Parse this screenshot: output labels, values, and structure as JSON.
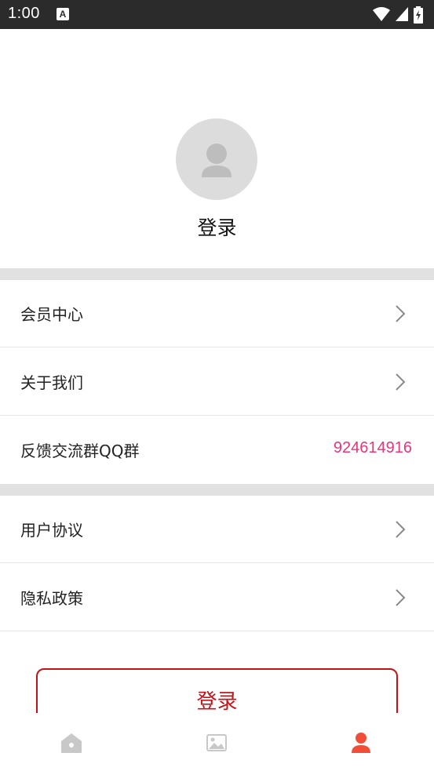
{
  "status_bar": {
    "time": "1:00",
    "notification_icon": "a-letter-icon",
    "indicators": [
      "wifi-icon",
      "signal-icon",
      "battery-charging-icon"
    ]
  },
  "profile": {
    "avatar_icon": "person-icon",
    "login_title": "登录"
  },
  "menu_groups": [
    {
      "items": [
        {
          "label": "会员中心",
          "action_icon": "chevron-right-icon"
        },
        {
          "label": "关于我们",
          "action_icon": "chevron-right-icon"
        },
        {
          "label": "反馈交流群QQ群",
          "value": "924614916"
        }
      ]
    },
    {
      "items": [
        {
          "label": "用户协议",
          "action_icon": "chevron-right-icon"
        },
        {
          "label": "隐私政策",
          "action_icon": "chevron-right-icon"
        }
      ]
    }
  ],
  "login_button": {
    "label": "登录"
  },
  "tab_bar": {
    "tabs": [
      {
        "icon": "home-icon",
        "active": false
      },
      {
        "icon": "image-icon",
        "active": false
      },
      {
        "icon": "person-icon",
        "active": true
      }
    ]
  },
  "colors": {
    "accent": "#c0141a",
    "value_pink": "#e8357c",
    "active_tab": "#f04e37",
    "inactive_tab": "#c8c8c8",
    "divider": "#e1e1e1"
  }
}
